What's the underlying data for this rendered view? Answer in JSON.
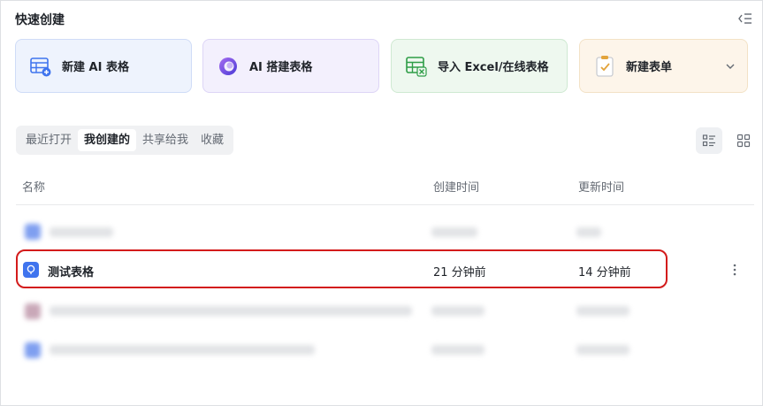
{
  "header": {
    "title": "快速创建"
  },
  "quick_create": [
    {
      "label": "新建 AI 表格",
      "icon": "table-add-icon",
      "color": "#3f74ee"
    },
    {
      "label": "AI 搭建表格",
      "icon": "ai-orb-icon",
      "color": "#7b4fe0"
    },
    {
      "label": "导入 Excel/在线表格",
      "icon": "excel-import-icon",
      "color": "#2e9d47"
    },
    {
      "label": "新建表单",
      "icon": "form-icon",
      "color": "#e3a43c"
    }
  ],
  "tabs": [
    {
      "label": "最近打开",
      "active": false
    },
    {
      "label": "我创建的",
      "active": true
    },
    {
      "label": "共享给我",
      "active": false
    },
    {
      "label": "收藏",
      "active": false
    }
  ],
  "columns": {
    "name": "名称",
    "created": "创建时间",
    "updated": "更新时间"
  },
  "highlighted_row": {
    "name": "测试表格",
    "created": "21 分钟前",
    "updated": "14 分钟前",
    "icon": "bitable-icon"
  },
  "colors": {
    "accent": "#3f74ee",
    "highlight_border": "#d31b1b"
  }
}
